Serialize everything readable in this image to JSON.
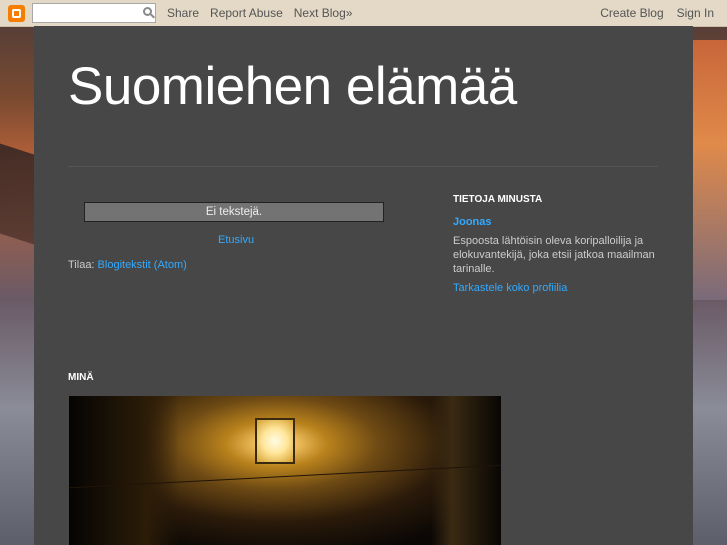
{
  "navbar": {
    "search_placeholder": "",
    "share_label": "Share",
    "report_abuse_label": "Report Abuse",
    "next_blog_label": "Next Blog»",
    "create_blog_label": "Create Blog",
    "sign_in_label": "Sign In"
  },
  "blog": {
    "title": "Suomiehen elämää",
    "no_posts_text": "Ei tekstejä.",
    "home_link": "Etusivu",
    "subscribe_prefix": "Tilaa: ",
    "subscribe_link": "Blogitekstit (Atom)"
  },
  "sidebar": {
    "about_heading": "TIETOJA MINUSTA",
    "profile_name": "Joonas",
    "profile_description": "Espoosta lähtöisin oleva koripalloilija ja elokuvantekijä, joka etsii jatkoa maailman tarinalle.",
    "profile_link": "Tarkastele koko profiilia"
  },
  "mina": {
    "heading": "MINÄ"
  },
  "colors": {
    "accent_link": "#33aaff",
    "content_bg": "#474747",
    "navbar_bg": "#e3d9c6",
    "blogger_orange": "#f57d00"
  }
}
